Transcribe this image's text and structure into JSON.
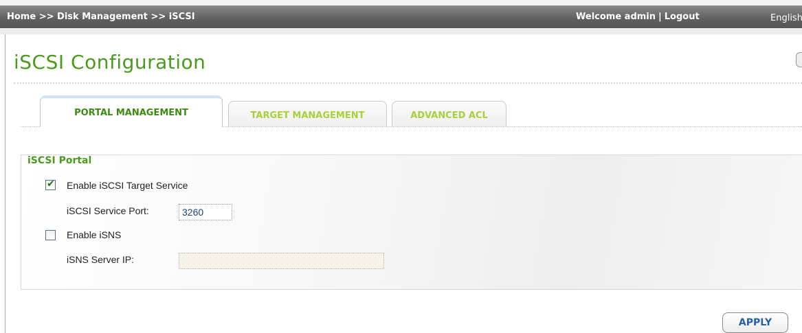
{
  "breadcrumb": {
    "home": "Home",
    "sep1": ">>",
    "section": "Disk Management",
    "sep2": ">>",
    "page": "iSCSI"
  },
  "header": {
    "welcome": "Welcome admin",
    "separator": "|",
    "logout": "Logout",
    "language": "English"
  },
  "page_title": "iSCSI Configuration",
  "tabs": [
    {
      "label": "PORTAL MANAGEMENT",
      "active": true
    },
    {
      "label": "TARGET MANAGEMENT",
      "active": false
    },
    {
      "label": "ADVANCED ACL",
      "active": false
    }
  ],
  "portal": {
    "legend": "iSCSI Portal",
    "enable_target_label": "Enable iSCSI Target Service",
    "enable_target_checked": true,
    "port_label": "iSCSI Service Port:",
    "port_value": "3260",
    "enable_isns_label": "Enable iSNS",
    "enable_isns_checked": false,
    "isns_ip_label": "iSNS Server IP:",
    "isns_ip_value": ""
  },
  "actions": {
    "apply_label": "APPLY"
  },
  "colors": {
    "title_green": "#4a9a1c",
    "tab_inactive_green": "#a8d03a",
    "apply_blue": "#2460a8"
  }
}
